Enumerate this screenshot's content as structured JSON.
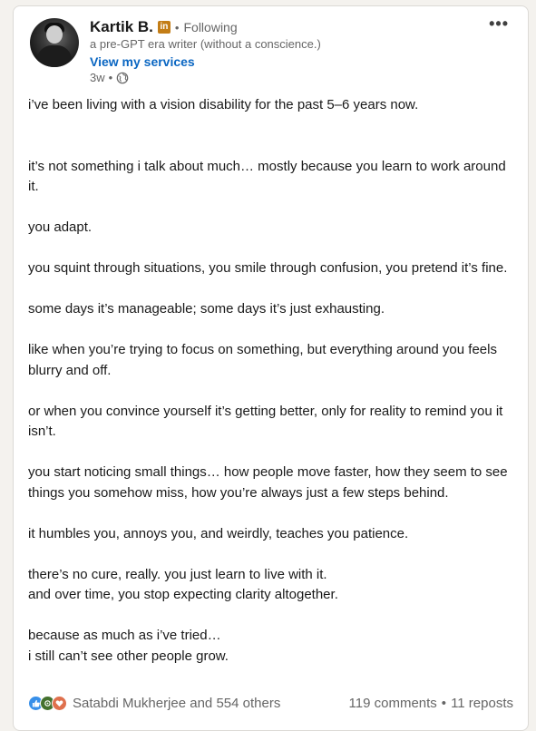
{
  "author": {
    "name": "Kartik B.",
    "badge": "in",
    "connection_status": "Following",
    "headline": "a pre-GPT era writer (without a conscience.)",
    "services_link": "View my services"
  },
  "meta": {
    "time_ago": "3w",
    "visibility_icon": "globe-icon"
  },
  "menu": {
    "more_label": "•••"
  },
  "post": {
    "paragraphs": [
      "i’ve been living with a vision disability for the past 5–6 years now.",
      "it’s not something i talk about much… mostly because you learn to work around it.",
      "you adapt.",
      "you squint through situations, you smile through confusion, you pretend it’s fine.",
      "some days it’s manageable; some days it’s just exhausting.",
      "like when you’re trying to focus on something, but everything around you feels blurry and off.",
      "or when you convince yourself it’s getting better, only for reality to remind you it isn’t.",
      "you start noticing small things… how people move faster, how they seem to see things you somehow miss, how you’re always just a few steps behind.",
      "it humbles you, annoys you, and weirdly, teaches you patience.",
      "there’s no cure, really. you just learn to live with it.\nand over time, you stop expecting clarity altogether.",
      "because as much as i’ve tried…\ni still can’t see other people grow."
    ]
  },
  "social": {
    "reaction_icons": [
      "like-icon",
      "celebrate-icon",
      "love-icon"
    ],
    "reactions_text": "Satabdi Mukherjee and 554 others",
    "comments_text": "119 comments",
    "reposts_text": "11 reposts",
    "separator": "•"
  },
  "colors": {
    "link_blue": "#0a66c2",
    "badge_gold": "#c37d16",
    "like_blue": "#378fe9",
    "celebrate_green": "#44712e",
    "love_orange": "#df704d"
  }
}
